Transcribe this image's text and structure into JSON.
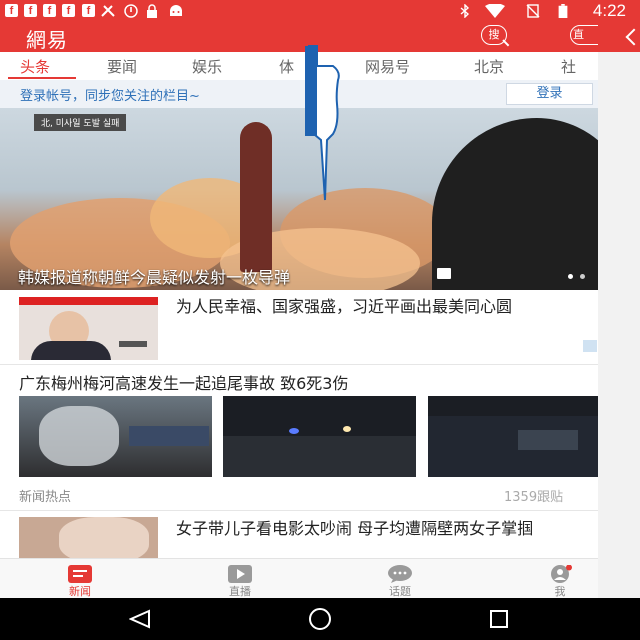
{
  "status_bar": {
    "time": "4:22",
    "notification_icons": [
      "facebook-icon",
      "facebook-icon",
      "facebook-icon",
      "facebook-icon",
      "tools-icon",
      "alarm-icon",
      "lock-icon",
      "android-icon"
    ],
    "system_icons": [
      "bluetooth-icon",
      "wifi-icon",
      "no-sim-icon",
      "battery-icon"
    ]
  },
  "header": {
    "logo": "網易",
    "search_label": "搜",
    "live_label": "直"
  },
  "tabs": [
    {
      "label": "头条",
      "active": true
    },
    {
      "label": "要闻"
    },
    {
      "label": "娱乐"
    },
    {
      "label": "体"
    },
    {
      "label": "网易号"
    },
    {
      "label": "北京"
    },
    {
      "label": "社"
    }
  ],
  "login_bar": {
    "prompt": "登录帐号，同步您关注的栏目~",
    "button": "登录"
  },
  "hero": {
    "caption": "韩媒报道称朝鲜今晨疑似发射一枚导弹",
    "sign_text": "北, 미사일 도발 실패"
  },
  "news": [
    {
      "title": "为人民幸福、国家强盛，习近平画出最美同心圆"
    },
    {
      "title": "广东梅州梅河高速发生一起追尾事故 致6死3伤",
      "source": "新闻热点",
      "count": "1359跟贴"
    },
    {
      "title": "女子带儿子看电影太吵闹 母子均遭隔壁两女子掌掴"
    }
  ],
  "bottom_nav": [
    {
      "label": "新闻",
      "icon": "news-icon",
      "active": true
    },
    {
      "label": "直播",
      "icon": "play-icon"
    },
    {
      "label": "话题",
      "icon": "chat-bubble-icon"
    },
    {
      "label": "我",
      "icon": "user-icon"
    }
  ],
  "colors": {
    "accent": "#e53935",
    "link": "#2f71b8"
  }
}
